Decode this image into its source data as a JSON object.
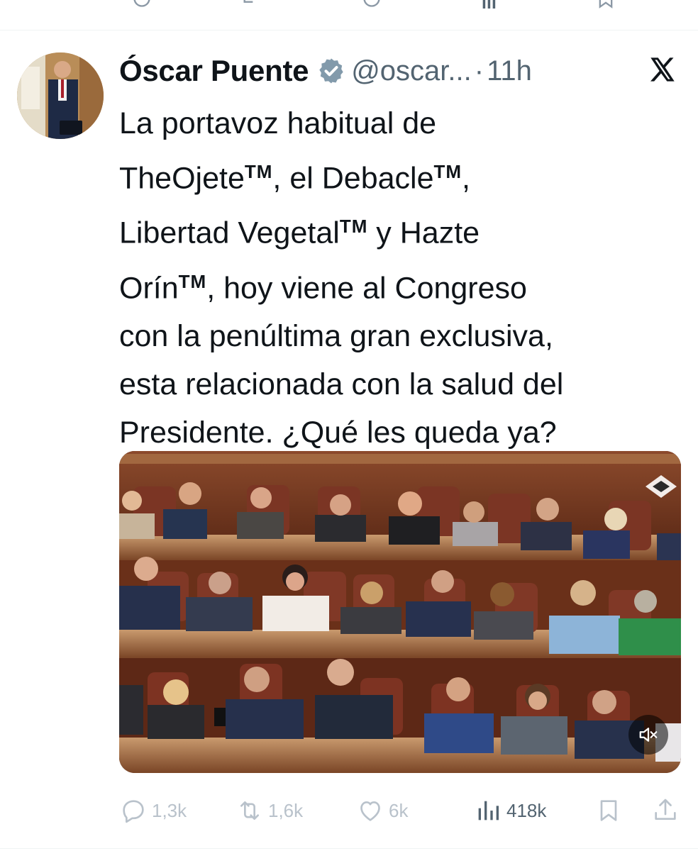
{
  "author": {
    "name": "Óscar Puente",
    "handle": "@oscar...",
    "separator": "·",
    "time": "11h"
  },
  "tweet": {
    "l1": "La portavoz habitual de",
    "l2a": "TheOjete",
    "l2b": ", el Debacle",
    "l2c": ",",
    "l3a": "Libertad Vegetal",
    "l3b": " y Hazte",
    "l4a": "Orín",
    "l4b": ", hoy viene al Congreso",
    "l5": "con la penúltima gran exclusiva,",
    "l6": "esta relacionada con la salud del",
    "l7": "Presidente. ¿Qué les queda ya?",
    "tm": "TM"
  },
  "actions": {
    "replies": "1,3k",
    "reposts": "1,6k",
    "likes": "6k",
    "views": "418k"
  },
  "icons": {
    "verified": "verified-badge-icon",
    "x_logo": "x-logo-icon",
    "reply": "reply-icon",
    "repost": "repost-icon",
    "like": "heart-icon",
    "views": "views-icon",
    "bookmark": "bookmark-icon",
    "share": "share-icon",
    "mute": "mute-icon",
    "channel_logo": "channel-logo-icon"
  },
  "colors": {
    "text": "#0f1419",
    "muted": "#536471",
    "faint_icons": "#b9c2cb",
    "verified": "#829aab"
  }
}
